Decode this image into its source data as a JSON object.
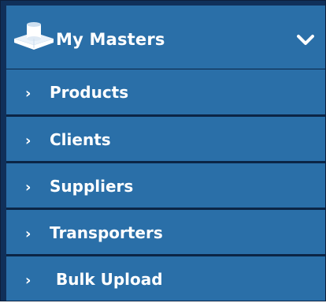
{
  "menu": {
    "title": "My Masters",
    "icon": "database-icon",
    "expand_icon": "chevron-down-icon",
    "colors": {
      "background": "#2a6fa8",
      "border": "#0b2546",
      "text": "#ffffff"
    },
    "items": [
      {
        "label": "Products",
        "arrow": "›"
      },
      {
        "label": "Clients",
        "arrow": "›"
      },
      {
        "label": "Suppliers",
        "arrow": "›"
      },
      {
        "label": "Transporters",
        "arrow": "›"
      },
      {
        "label": "Bulk Upload",
        "arrow": "›"
      }
    ]
  }
}
